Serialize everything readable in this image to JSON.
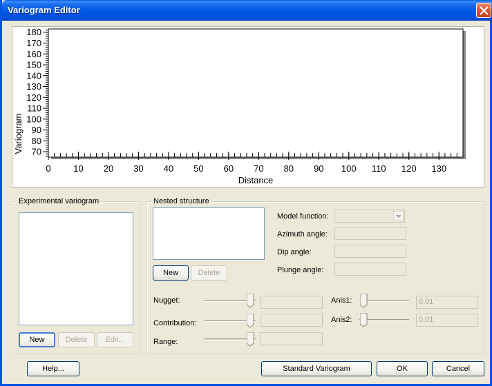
{
  "window": {
    "title": "Variogram Editor"
  },
  "chart_data": {
    "type": "line",
    "title": "",
    "xlabel": "Distance",
    "ylabel": "Variogram",
    "xlim": [
      0,
      138
    ],
    "ylim": [
      65,
      183
    ],
    "x_ticks": [
      0,
      10,
      20,
      30,
      40,
      50,
      60,
      70,
      80,
      90,
      100,
      110,
      120,
      130
    ],
    "y_ticks": [
      70,
      80,
      90,
      100,
      110,
      120,
      130,
      140,
      150,
      160,
      170,
      180
    ],
    "grid": false,
    "series": []
  },
  "experimental": {
    "legend": "Experimental variogram",
    "new_label": "New",
    "delete_label": "Delete",
    "edit_label": "Edit..."
  },
  "nested": {
    "legend": "Nested structure",
    "new_label": "New",
    "delete_label": "Delete",
    "model_function_label": "Model function:",
    "azimuth_label": "Azimuth angle:",
    "dip_label": "Dip angle:",
    "plunge_label": "Plunge angle:",
    "model_function_value": "",
    "azimuth_value": "",
    "dip_value": "",
    "plunge_value": "",
    "nugget_label": "Nugget:",
    "contribution_label": "Contribution:",
    "range_label": "Range:",
    "nugget_value": "",
    "contribution_value": "",
    "range_value": "",
    "anis1_label": "Anis1:",
    "anis2_label": "Anis2:",
    "anis1_value": "0.01",
    "anis2_value": "0.01"
  },
  "sliders": {
    "nugget_level": 0.97,
    "contribution_level": 0.97,
    "range_level": 0.97,
    "anis1_level": 0.02,
    "anis2_level": 0.02
  },
  "footer": {
    "help_label": "Help...",
    "standard_label": "Standard  Variogram",
    "ok_label": "OK",
    "cancel_label": "Cancel"
  }
}
